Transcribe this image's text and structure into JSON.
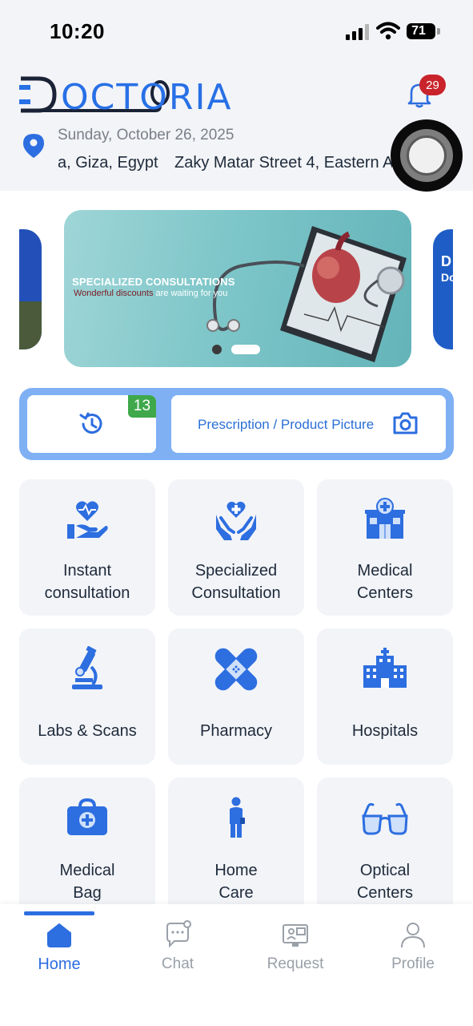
{
  "status_bar": {
    "time": "10:20",
    "battery": "71"
  },
  "header": {
    "brand": "OCTORIA",
    "notification_count": "29",
    "date": "Sunday, October 26, 2025",
    "address_part1": "a, Giza, Egypt",
    "address_part2": "Zaky Matar Street 4, Eastern Al"
  },
  "banner": {
    "title": "SPECIALIZED CONSULTATIONS",
    "subtitle_highlight": "Wonderful discounts",
    "subtitle_rest": " are waiting for you",
    "right_peek_line1": "D",
    "right_peek_line2": "Do"
  },
  "actions": {
    "history_count": "13",
    "prescription_label": "Prescription / Product Picture"
  },
  "services": [
    {
      "line1": "Instant",
      "line2": "consultation",
      "icon": "heart-hand-icon"
    },
    {
      "line1": "Specialized",
      "line2": "Consultation",
      "icon": "hands-heart-icon"
    },
    {
      "line1": "Medical",
      "line2": "Centers",
      "icon": "medical-center-icon"
    },
    {
      "line1": "Labs & Scans",
      "line2": "",
      "icon": "microscope-icon"
    },
    {
      "line1": "Pharmacy",
      "line2": "",
      "icon": "bandage-icon"
    },
    {
      "line1": "Hospitals",
      "line2": "",
      "icon": "hospital-icon"
    },
    {
      "line1": "Medical",
      "line2": "Bag",
      "icon": "medical-bag-icon"
    },
    {
      "line1": "Home",
      "line2": "Care",
      "icon": "caregiver-icon"
    },
    {
      "line1": "Optical",
      "line2": "Centers",
      "icon": "glasses-icon"
    }
  ],
  "bottom_nav": [
    {
      "label": "Home",
      "active": true
    },
    {
      "label": "Chat",
      "active": false
    },
    {
      "label": "Request",
      "active": false
    },
    {
      "label": "Profile",
      "active": false
    }
  ],
  "colors": {
    "primary": "#2d6ee0",
    "badge_red": "#c9232c",
    "badge_green": "#3ea84a",
    "action_bar": "#7fb0f4",
    "card_bg": "#f2f4f8"
  }
}
